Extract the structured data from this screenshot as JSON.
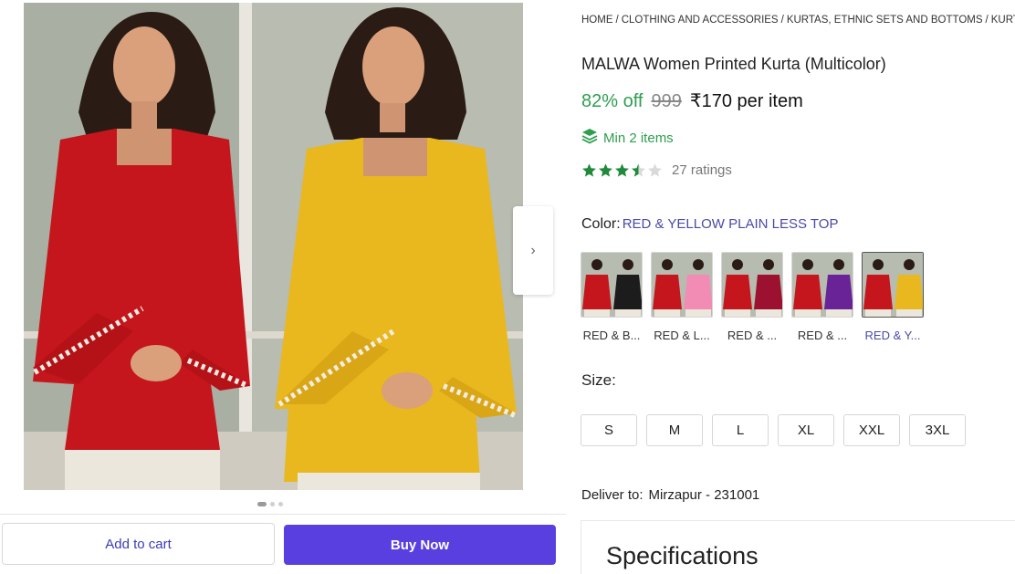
{
  "breadcrumbs": [
    "HOME",
    "CLOTHING AND ACCESSORIES",
    "KURTAS, ETHNIC SETS AND BOTTOMS",
    "KURTAS"
  ],
  "product": {
    "title": "MALWA Women Printed Kurta (Multicolor)",
    "discount": "82% off",
    "mrp": "999",
    "price": "₹170 per item",
    "min_order": "Min 2 items",
    "rating_value": 3.5,
    "ratings_count": "27 ratings"
  },
  "color": {
    "label": "Color:",
    "selected": "RED & YELLOW PLAIN LESS TOP",
    "options": [
      {
        "label": "RED & B...",
        "left": "#c4161c",
        "right": "#1c1c1c"
      },
      {
        "label": "RED & L...",
        "left": "#c4161c",
        "right": "#f28cb4"
      },
      {
        "label": "RED & ...",
        "left": "#c4161c",
        "right": "#9c1030"
      },
      {
        "label": "RED & ...",
        "left": "#c4161c",
        "right": "#6a2396"
      },
      {
        "label": "RED & Y...",
        "left": "#c4161c",
        "right": "#e8b81e"
      }
    ],
    "selected_index": 4
  },
  "size": {
    "label": "Size:",
    "options": [
      "S",
      "M",
      "L",
      "XL",
      "XXL",
      "3XL"
    ]
  },
  "delivery": {
    "label": "Deliver to:",
    "location": "Mirzapur - 231001"
  },
  "specs": {
    "title": "Specifications"
  },
  "actions": {
    "add_to_cart": "Add to cart",
    "buy_now": "Buy Now"
  },
  "icons": {
    "next": "chevron-right-icon",
    "min_order": "layers-icon",
    "star": "star-icon"
  },
  "colors": {
    "accent": "#5a3fe0",
    "green": "#2e9e4f",
    "link": "#4a4aa8",
    "kurta_red": "#c4161c",
    "kurta_yellow": "#e8b81e"
  },
  "carousel": {
    "slides": 3,
    "active": 0
  }
}
